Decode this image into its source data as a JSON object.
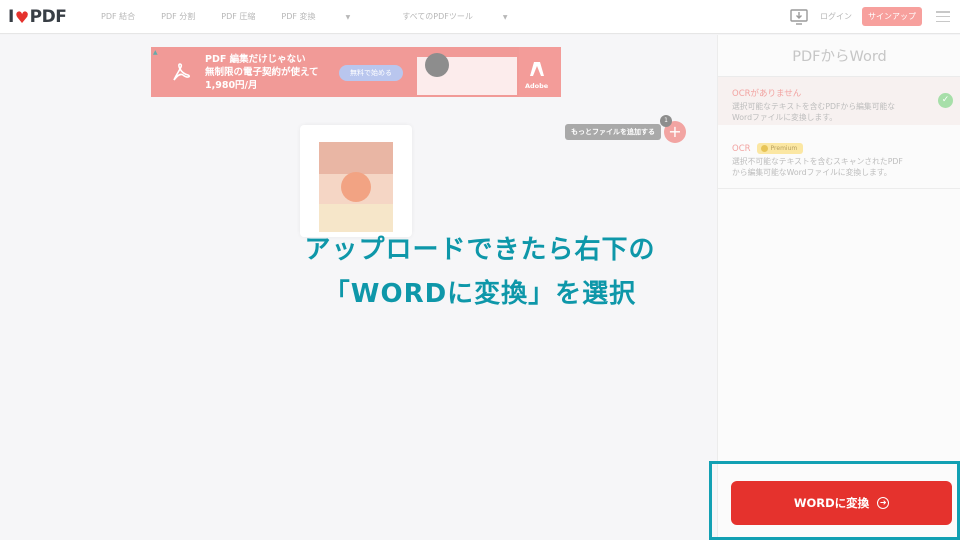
{
  "header": {
    "logo_left": "I",
    "logo_right": "PDF",
    "nav": [
      {
        "label": "PDF 結合"
      },
      {
        "label": "PDF 分割"
      },
      {
        "label": "PDF 圧縮"
      },
      {
        "label": "PDF 変換"
      },
      {
        "label": "すべてのPDFツール"
      }
    ],
    "login_label": "ログイン",
    "signup_label": "サインアップ"
  },
  "ad": {
    "line1": "PDF 編集だけじゃない",
    "line2": "無制限の電子契約が使えて",
    "line3": "1,980円/月",
    "button": "無料で始める",
    "brand": "Adobe"
  },
  "upload": {
    "add_files_label": "もっとファイルを追加する",
    "file_count": "1",
    "add_symbol": "+"
  },
  "instruction": {
    "line1": "アップロードできたら右下の",
    "line2": "「WORDに変換」を選択"
  },
  "sidebar": {
    "title": "PDFからWord",
    "options": [
      {
        "title": "OCRがありません",
        "desc1": "選択可能なテキストを含むPDFから編集可能な",
        "desc2": "Wordファイルに変換します。",
        "selected": true
      },
      {
        "title": "OCR",
        "badge": "Premium",
        "desc1": "選択不可能なテキストを含むスキャンされたPDF",
        "desc2": "から編集可能なWordファイルに変換します。",
        "selected": false
      }
    ],
    "convert_label": "WORDに変換"
  },
  "colors": {
    "brand_red": "#e5322d",
    "instruction_teal": "#0e97a9",
    "highlight_border": "#12a0b3"
  }
}
